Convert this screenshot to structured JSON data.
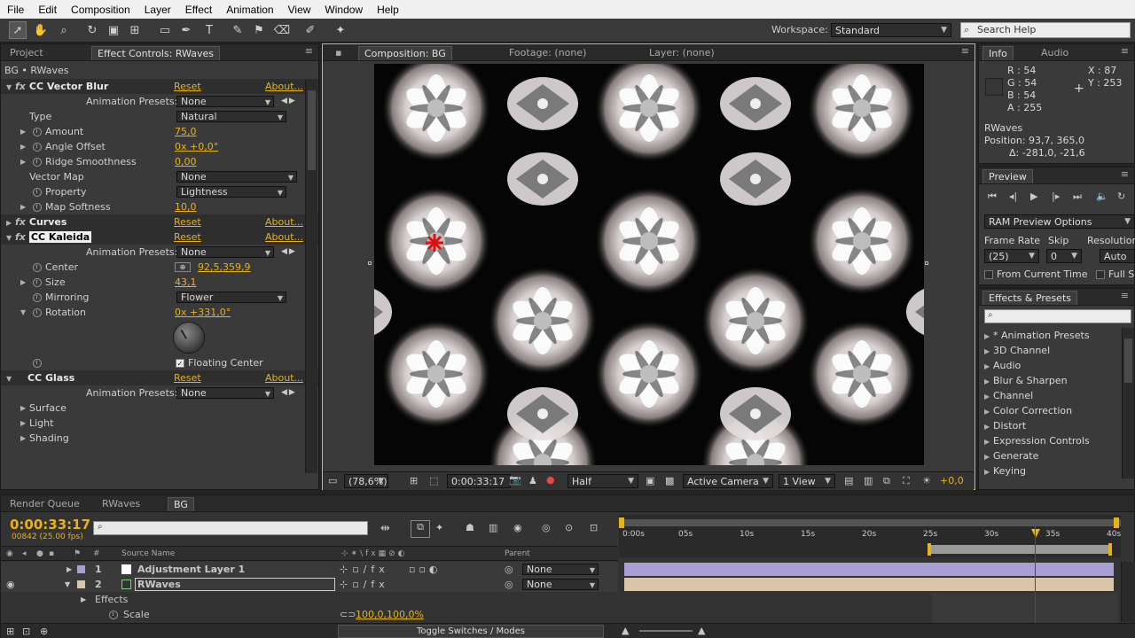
{
  "menu": [
    "File",
    "Edit",
    "Composition",
    "Layer",
    "Effect",
    "Animation",
    "View",
    "Window",
    "Help"
  ],
  "toolbar": {
    "workspace_label": "Workspace:",
    "workspace_value": "Standard",
    "search_placeholder": "Search Help"
  },
  "left_panel": {
    "tabs": [
      "Project",
      "Effect Controls: RWaves"
    ],
    "layer_title": "BG • RWaves",
    "reset": "Reset",
    "about": "About...",
    "effects": [
      {
        "name": "CC Vector Blur"
      },
      {
        "name": "Curves"
      },
      {
        "name": "CC Kaleida"
      },
      {
        "name": "CC Glass"
      }
    ],
    "animation_presets_label": "Animation Presets:",
    "animation_presets_value": "None",
    "vector_blur": {
      "type_label": "Type",
      "type_value": "Natural",
      "amount_label": "Amount",
      "amount_value": "75,0",
      "angle_label": "Angle Offset",
      "angle_value": "0x +0,0°",
      "ridge_label": "Ridge Smoothness",
      "ridge_value": "0,00",
      "vector_map_label": "Vector Map",
      "vector_map_value": "None",
      "property_label": "Property",
      "property_value": "Lightness",
      "map_softness_label": "Map Softness",
      "map_softness_value": "10,0"
    },
    "kaleida": {
      "center_label": "Center",
      "center_value": "92,5,359,9",
      "size_label": "Size",
      "size_value": "43,1",
      "mirroring_label": "Mirroring",
      "mirroring_value": "Flower",
      "rotation_label": "Rotation",
      "rotation_value": "0x +331,0°",
      "floating_center_label": "Floating Center"
    },
    "glass": {
      "surface_label": "Surface",
      "light_label": "Light",
      "shading_label": "Shading"
    }
  },
  "comp_panel": {
    "tabs": [
      "Composition: BG",
      "Footage: (none)",
      "Layer: (none)"
    ],
    "zoom": "(78,6%)",
    "timecode": "0:00:33:17",
    "resolution": "Half",
    "camera": "Active Camera",
    "views": "1 View",
    "exposure": "+0,0"
  },
  "info_panel": {
    "tabs": [
      "Info",
      "Audio"
    ],
    "r": "R : 54",
    "g": "G : 54",
    "b": "B : 54",
    "a": "A : 255",
    "x": "X : 87",
    "y": "Y : 253",
    "layer_name": "RWaves",
    "position": "Position: 93,7, 365,0",
    "delta": "Δ: -281,0, -21,6"
  },
  "preview_panel": {
    "tab": "Preview",
    "options": "RAM Preview Options",
    "frame_rate_label": "Frame Rate",
    "skip_label": "Skip",
    "resolution_label": "Resolution",
    "frame_rate_value": "(25)",
    "skip_value": "0",
    "resolution_value": "Auto",
    "from_current": "From Current Time",
    "full_screen": "Full Sc"
  },
  "effects_presets": {
    "tab": "Effects & Presets",
    "items": [
      "* Animation Presets",
      "3D Channel",
      "Audio",
      "Blur & Sharpen",
      "Channel",
      "Color Correction",
      "Distort",
      "Expression Controls",
      "Generate",
      "Keying"
    ]
  },
  "timeline": {
    "tabs": [
      "Render Queue",
      "RWaves",
      "BG"
    ],
    "timecode": "0:00:33:17",
    "frame_info": "00842 (25.00 fps)",
    "col_source": "Source Name",
    "col_parent": "Parent",
    "col_num": "#",
    "ruler": [
      "0:00s",
      "05s",
      "10s",
      "15s",
      "20s",
      "25s",
      "30s",
      "35s",
      "40s"
    ],
    "layers": [
      {
        "num": "1",
        "name": "Adjustment Layer 1",
        "parent": "None"
      },
      {
        "num": "2",
        "name": "RWaves",
        "parent": "None"
      }
    ],
    "effects_label": "Effects",
    "scale_label": "Scale",
    "scale_value": "100,0,100,0%",
    "toggle_label": "Toggle Switches / Modes"
  },
  "colors": {
    "accent_value": "#e7b21a",
    "timecode": "#e7b21a",
    "adjustment_bar": "#a79fd6",
    "rwaves_bar": "#d9c6a8",
    "playhead": "#e01010"
  }
}
